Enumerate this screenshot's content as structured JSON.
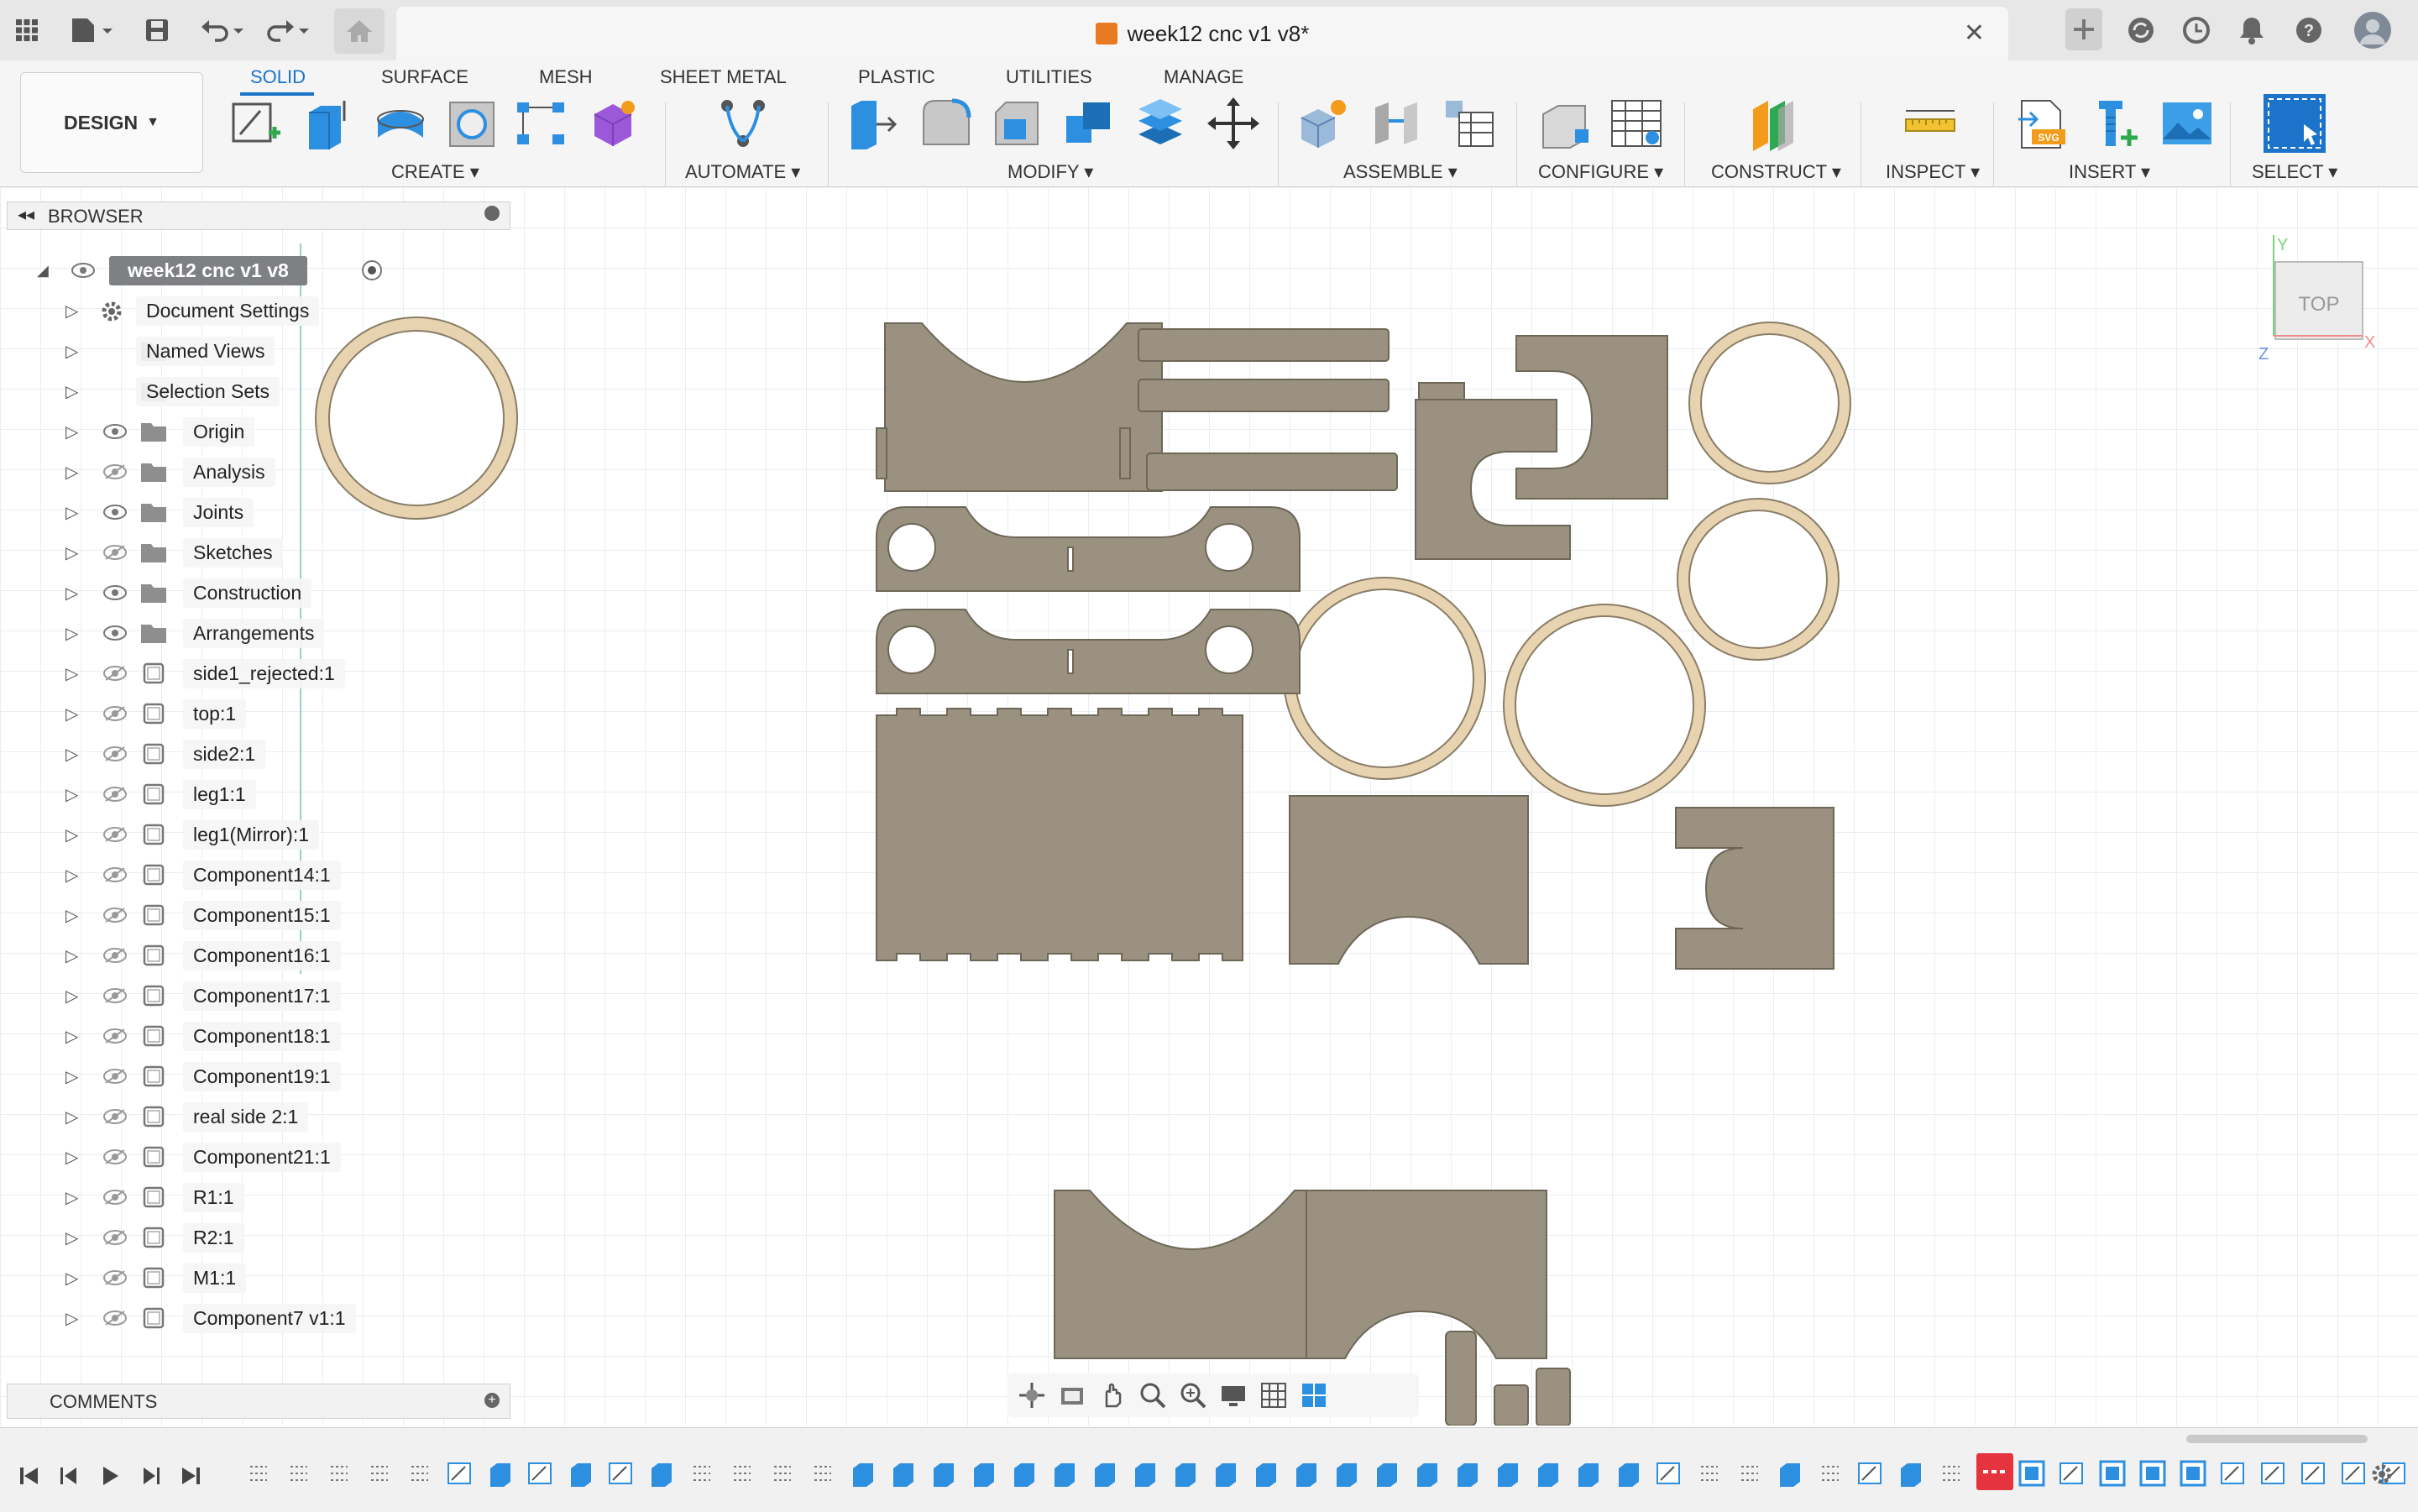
{
  "window": {
    "document_title": "week12 cnc v1 v8*",
    "close_glyph": "✕"
  },
  "ribbon": {
    "workspace_label": "DESIGN",
    "tabs": [
      {
        "label": "SOLID",
        "active": true
      },
      {
        "label": "SURFACE",
        "active": false
      },
      {
        "label": "MESH",
        "active": false
      },
      {
        "label": "SHEET METAL",
        "active": false
      },
      {
        "label": "PLASTIC",
        "active": false
      },
      {
        "label": "UTILITIES",
        "active": false
      },
      {
        "label": "MANAGE",
        "active": false
      }
    ],
    "groups": [
      {
        "label": "CREATE ▾"
      },
      {
        "label": "AUTOMATE ▾"
      },
      {
        "label": "MODIFY ▾"
      },
      {
        "label": "ASSEMBLE ▾"
      },
      {
        "label": "CONFIGURE ▾"
      },
      {
        "label": "CONSTRUCT ▾"
      },
      {
        "label": "INSPECT ▾"
      },
      {
        "label": "INSERT ▾"
      },
      {
        "label": "SELECT ▾"
      }
    ]
  },
  "browser": {
    "title": "BROWSER",
    "root": "week12 cnc v1 v8",
    "items": [
      {
        "label": "Document Settings",
        "icon": "gear-icon"
      },
      {
        "label": "Named Views",
        "icon": "folder-icon"
      },
      {
        "label": "Selection Sets",
        "icon": "folder-icon"
      },
      {
        "label": "Origin",
        "icon": "folder-icon",
        "visible": true
      },
      {
        "label": "Analysis",
        "icon": "folder-icon",
        "visible": false
      },
      {
        "label": "Joints",
        "icon": "folder-icon",
        "visible": true
      },
      {
        "label": "Sketches",
        "icon": "folder-icon",
        "visible": false
      },
      {
        "label": "Construction",
        "icon": "folder-icon",
        "visible": true
      },
      {
        "label": "Arrangements",
        "icon": "folder-icon",
        "visible": true
      },
      {
        "label": "side1_rejected:1",
        "icon": "component-icon",
        "visible": false
      },
      {
        "label": "top:1",
        "icon": "component-icon",
        "visible": false
      },
      {
        "label": "side2:1",
        "icon": "component-icon",
        "visible": false
      },
      {
        "label": "leg1:1",
        "icon": "component-icon",
        "visible": false
      },
      {
        "label": "leg1(Mirror):1",
        "icon": "component-icon",
        "visible": false
      },
      {
        "label": "Component14:1",
        "icon": "component-icon",
        "visible": false
      },
      {
        "label": "Component15:1",
        "icon": "component-icon",
        "visible": false
      },
      {
        "label": "Component16:1",
        "icon": "component-icon",
        "visible": false
      },
      {
        "label": "Component17:1",
        "icon": "component-icon",
        "visible": false
      },
      {
        "label": "Component18:1",
        "icon": "component-icon",
        "visible": false
      },
      {
        "label": "Component19:1",
        "icon": "component-icon",
        "visible": false
      },
      {
        "label": "real side 2:1",
        "icon": "component-icon",
        "visible": false
      },
      {
        "label": "Component21:1",
        "icon": "component-icon",
        "visible": false
      },
      {
        "label": "R1:1",
        "icon": "component-icon",
        "visible": false
      },
      {
        "label": "R2:1",
        "icon": "component-icon",
        "visible": false
      },
      {
        "label": "M1:1",
        "icon": "component-icon",
        "visible": false
      },
      {
        "label": "Component7 v1:1",
        "icon": "component-icon",
        "visible": false
      }
    ]
  },
  "comments": {
    "title": "COMMENTS"
  },
  "viewcube": {
    "face_label": "TOP",
    "x_label": "X",
    "y_label": "Y",
    "z_label": "Z"
  },
  "colors": {
    "accent": "#1b74c9",
    "plywood": "#9a9180",
    "ring": "#e7d3b0",
    "timeline_marker": "#e5343d"
  }
}
